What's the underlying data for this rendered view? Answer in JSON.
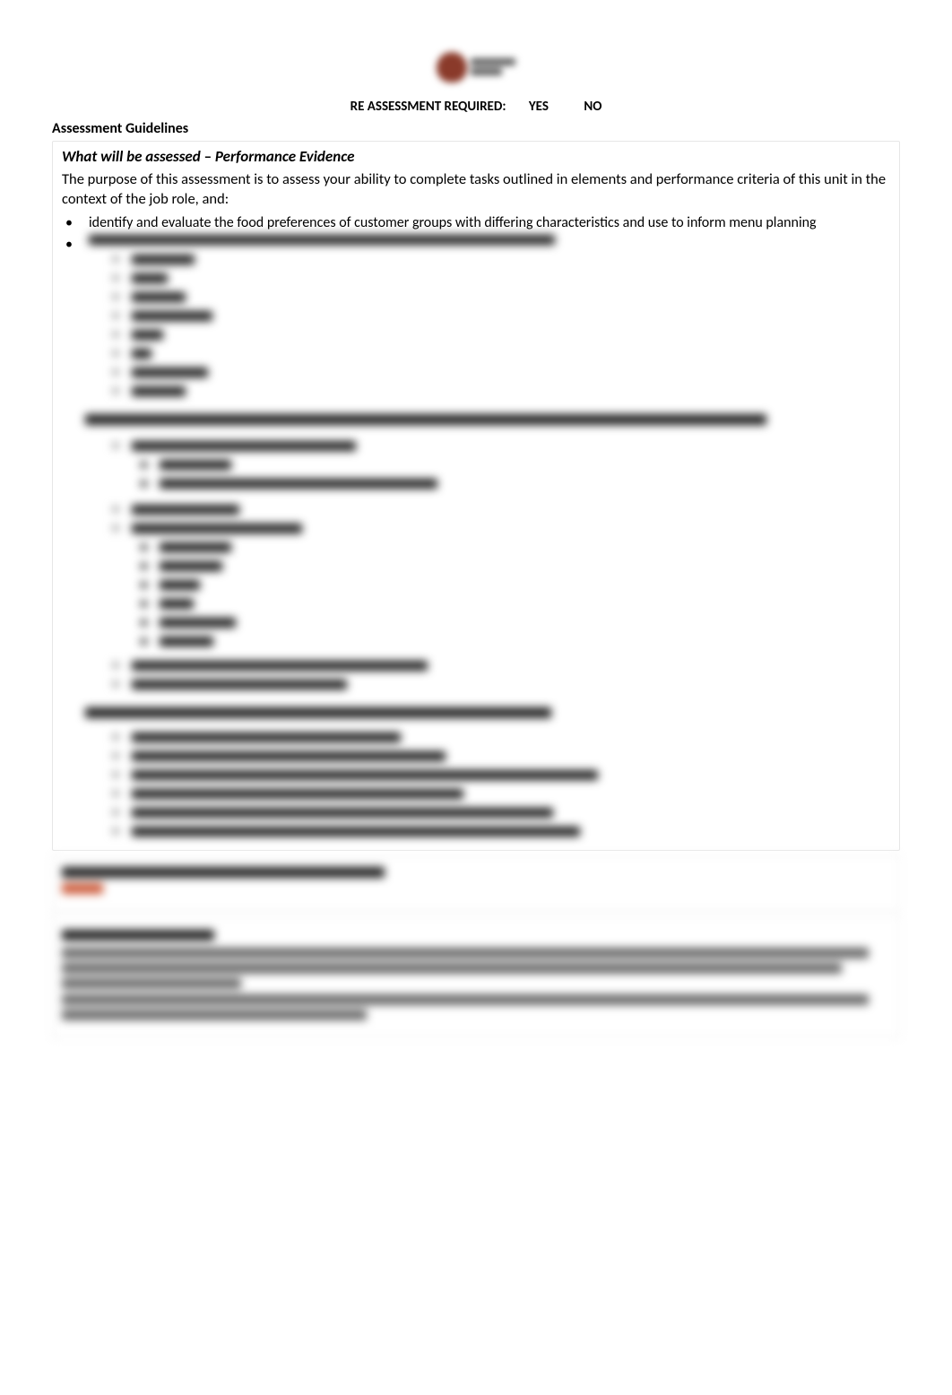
{
  "header": {
    "reassess_label": "RE ASSESSMENT REQUIRED:",
    "yes": "YES",
    "no": "NO"
  },
  "guidelines_title": "Assessment Guidelines",
  "section": {
    "sub_a": "What will be assessed",
    "sub_dash": " – ",
    "sub_b": "Performance Evidence",
    "intro": "The purpose of this assessment is to assess your ability to complete tasks outlined in elements and performance criteria of this unit in the context of the job role, and:",
    "bullets": [
      "identify and evaluate the food preferences of customer groups with differing characteristics and use to inform menu planning"
    ]
  }
}
